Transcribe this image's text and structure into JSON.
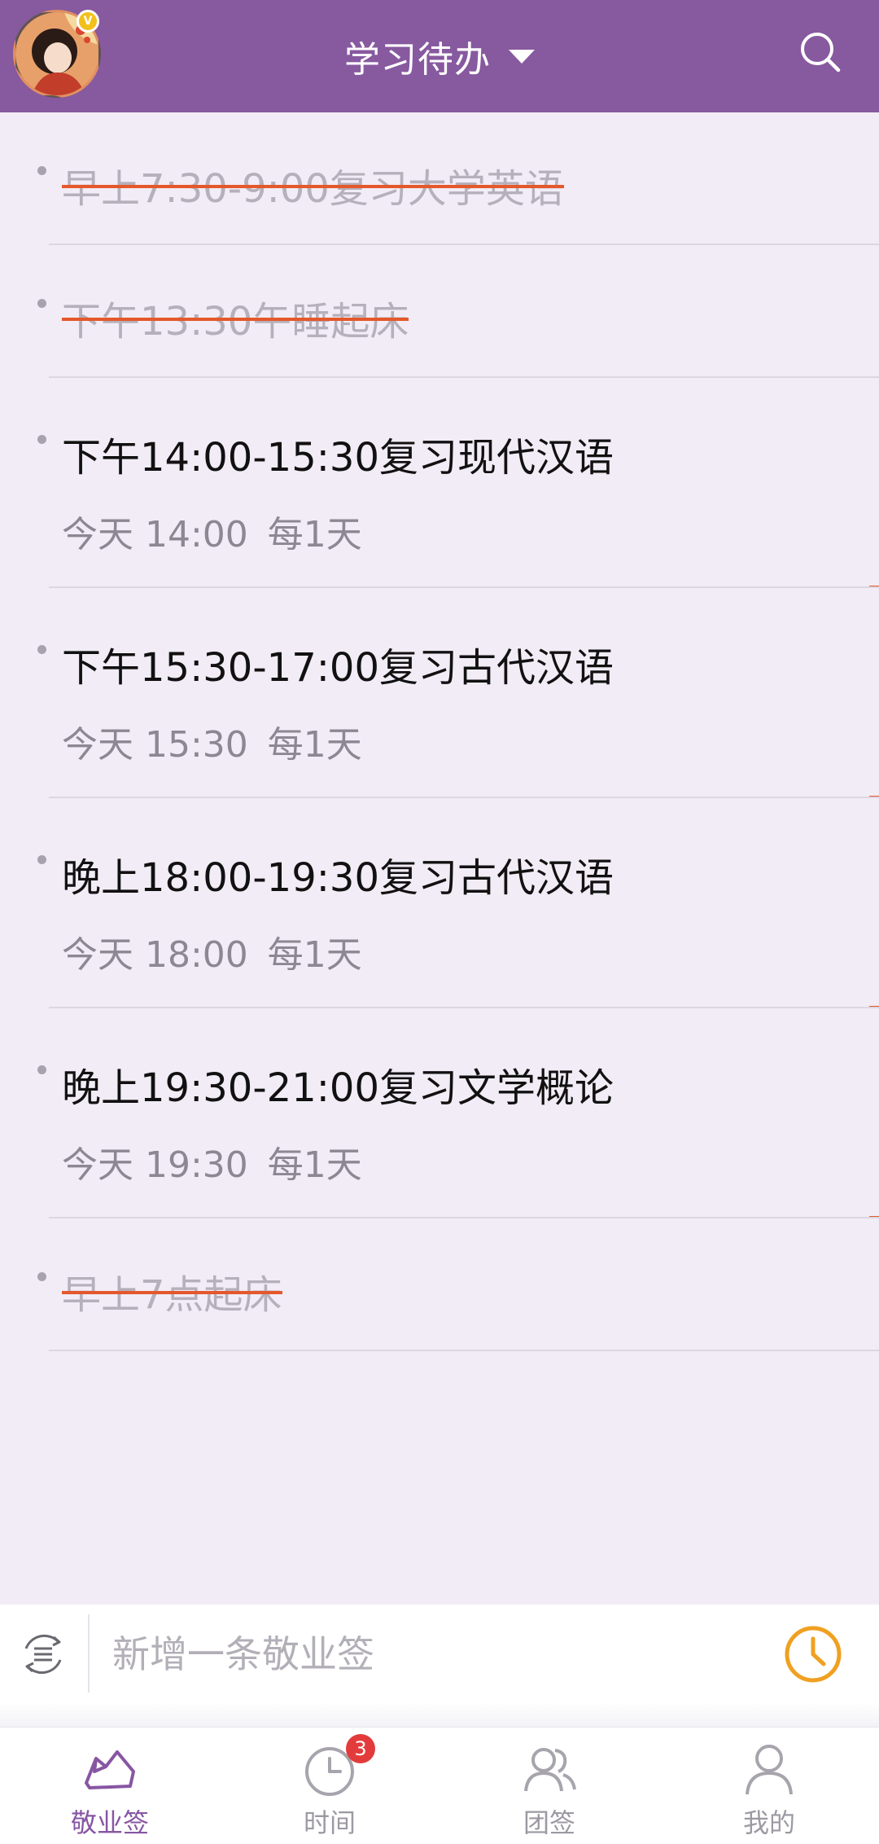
{
  "header": {
    "title": "学习待办",
    "avatar_badge": "V",
    "accent_color": "#87599f"
  },
  "todos": [
    {
      "title": "早上7:30-9:00复习大学英语",
      "done": true
    },
    {
      "title": "下午13:30午睡起床",
      "done": true
    },
    {
      "title": "下午14:00-15:30复习现代汉语",
      "done": false,
      "time": "今天 14:00",
      "repeat": "每1天"
    },
    {
      "title": "下午15:30-17:00复习古代汉语",
      "done": false,
      "time": "今天 15:30",
      "repeat": "每1天"
    },
    {
      "title": "晚上18:00-19:30复习古代汉语",
      "done": false,
      "time": "今天 18:00",
      "repeat": "每1天"
    },
    {
      "title": "晚上19:30-21:00复习文学概论",
      "done": false,
      "time": "今天 19:30",
      "repeat": "每1天"
    },
    {
      "title": "早上7点起床",
      "done": true
    }
  ],
  "input_bar": {
    "placeholder": "新增一条敬业签",
    "clock_color": "#f0a020"
  },
  "bottom_nav": {
    "items": [
      {
        "label": "敬业签",
        "icon": "note-icon",
        "active": true
      },
      {
        "label": "时间",
        "icon": "clock-icon",
        "badge": "3"
      },
      {
        "label": "团签",
        "icon": "group-icon"
      },
      {
        "label": "我的",
        "icon": "user-icon"
      }
    ]
  }
}
